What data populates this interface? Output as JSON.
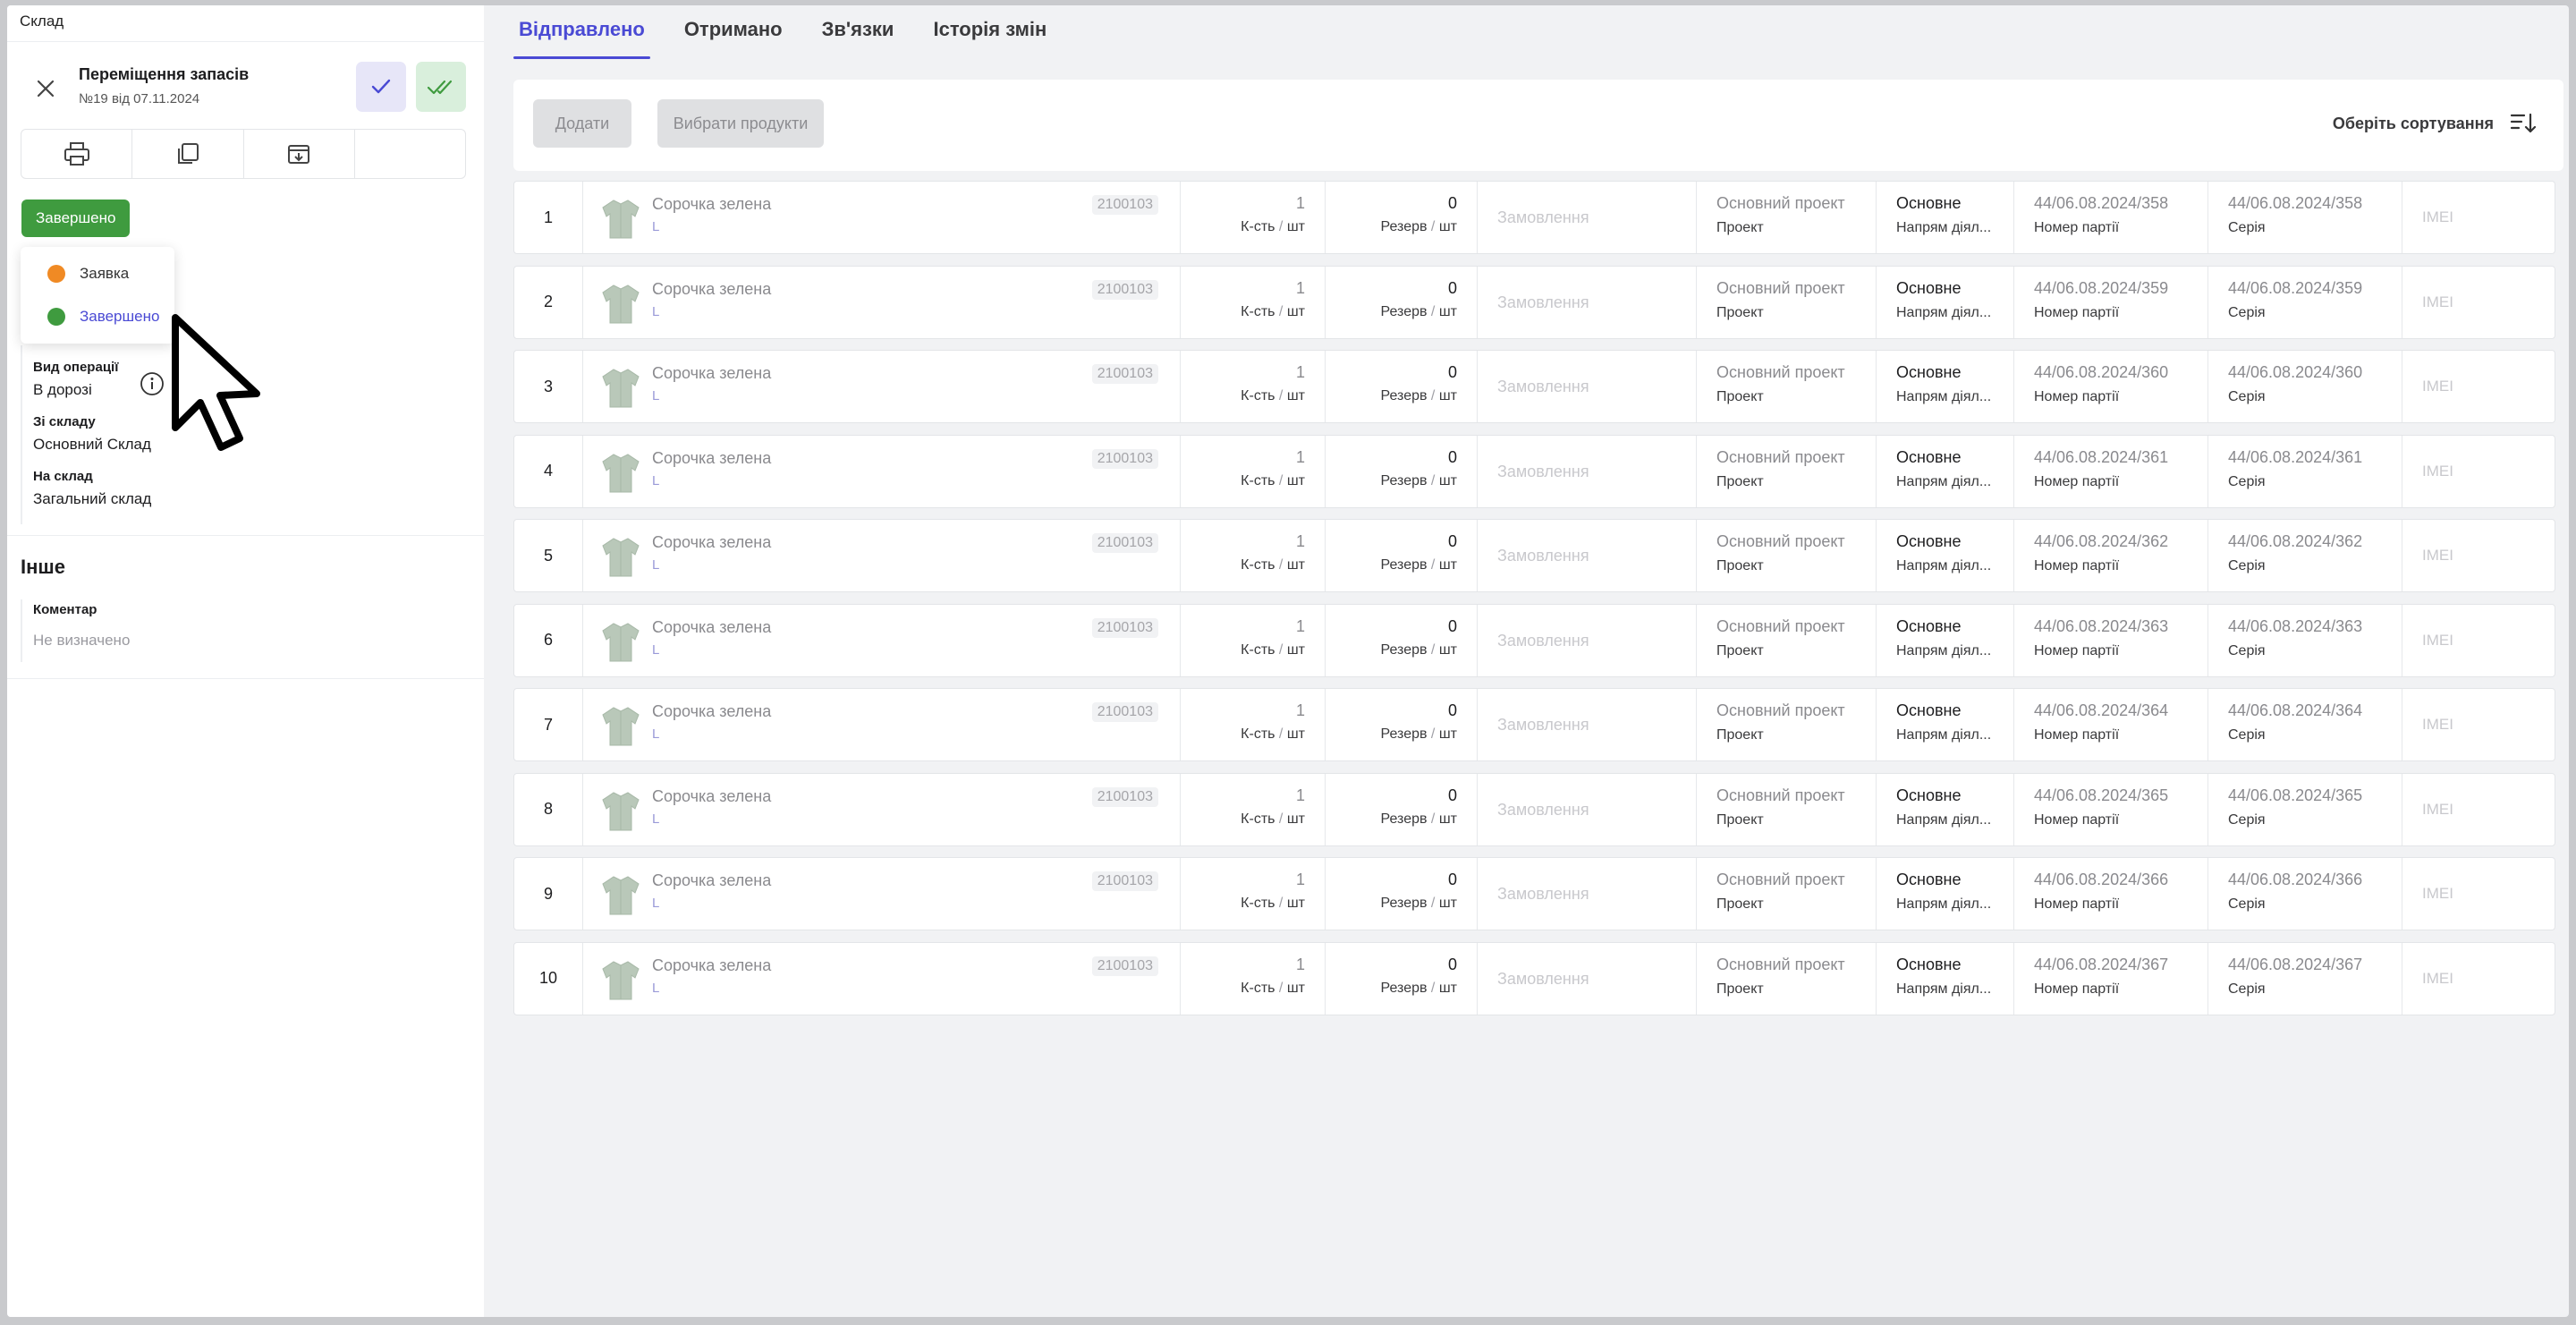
{
  "breadcrumb": "Склад",
  "document": {
    "title": "Переміщення запасів",
    "subtitle": "№19 від 07.11.2024"
  },
  "status": {
    "current": "Завершено",
    "options": [
      {
        "label": "Заявка",
        "color": "#f08a24"
      },
      {
        "label": "Завершено",
        "color": "#3f9b3f"
      }
    ]
  },
  "fields": {
    "operation_label": "Вид операції",
    "operation_value": "В дорозі",
    "from_label": "Зі складу",
    "from_value": "Основний Склад",
    "to_label": "На склад",
    "to_value": "Загальний склад"
  },
  "other": {
    "title": "Інше",
    "comment_label": "Коментар",
    "comment_value": "Не визначено"
  },
  "tabs": [
    "Відправлено",
    "Отримано",
    "Зв'язки",
    "Історія змін"
  ],
  "actions": {
    "add": "Додати",
    "select_products": "Вибрати продукти",
    "sort": "Оберіть сортування"
  },
  "colors": {
    "accent": "#4a4ad4",
    "success": "#3f9b3f",
    "warning": "#f08a24"
  },
  "rows": [
    {
      "num": "1",
      "name": "Сорочка зелена",
      "size": "L",
      "code": "2100103",
      "qty": "1",
      "qty_unit_a": "К-сть",
      "qty_unit_b": "шт",
      "res": "0",
      "res_unit_a": "Резерв",
      "res_unit_b": "шт",
      "order": "Замовлення",
      "project": "Основний проект",
      "project_label": "Проект",
      "direction": "Основне",
      "direction_label": "Напрям діял...",
      "batch": "44/06.08.2024/358",
      "batch_label": "Номер партії",
      "series": "44/06.08.2024/358",
      "series_label": "Серія",
      "imei": "IMEI"
    },
    {
      "num": "2",
      "name": "Сорочка зелена",
      "size": "L",
      "code": "2100103",
      "qty": "1",
      "qty_unit_a": "К-сть",
      "qty_unit_b": "шт",
      "res": "0",
      "res_unit_a": "Резерв",
      "res_unit_b": "шт",
      "order": "Замовлення",
      "project": "Основний проект",
      "project_label": "Проект",
      "direction": "Основне",
      "direction_label": "Напрям діял...",
      "batch": "44/06.08.2024/359",
      "batch_label": "Номер партії",
      "series": "44/06.08.2024/359",
      "series_label": "Серія",
      "imei": "IMEI"
    },
    {
      "num": "3",
      "name": "Сорочка зелена",
      "size": "L",
      "code": "2100103",
      "qty": "1",
      "qty_unit_a": "К-сть",
      "qty_unit_b": "шт",
      "res": "0",
      "res_unit_a": "Резерв",
      "res_unit_b": "шт",
      "order": "Замовлення",
      "project": "Основний проект",
      "project_label": "Проект",
      "direction": "Основне",
      "direction_label": "Напрям діял...",
      "batch": "44/06.08.2024/360",
      "batch_label": "Номер партії",
      "series": "44/06.08.2024/360",
      "series_label": "Серія",
      "imei": "IMEI"
    },
    {
      "num": "4",
      "name": "Сорочка зелена",
      "size": "L",
      "code": "2100103",
      "qty": "1",
      "qty_unit_a": "К-сть",
      "qty_unit_b": "шт",
      "res": "0",
      "res_unit_a": "Резерв",
      "res_unit_b": "шт",
      "order": "Замовлення",
      "project": "Основний проект",
      "project_label": "Проект",
      "direction": "Основне",
      "direction_label": "Напрям діял...",
      "batch": "44/06.08.2024/361",
      "batch_label": "Номер партії",
      "series": "44/06.08.2024/361",
      "series_label": "Серія",
      "imei": "IMEI"
    },
    {
      "num": "5",
      "name": "Сорочка зелена",
      "size": "L",
      "code": "2100103",
      "qty": "1",
      "qty_unit_a": "К-сть",
      "qty_unit_b": "шт",
      "res": "0",
      "res_unit_a": "Резерв",
      "res_unit_b": "шт",
      "order": "Замовлення",
      "project": "Основний проект",
      "project_label": "Проект",
      "direction": "Основне",
      "direction_label": "Напрям діял...",
      "batch": "44/06.08.2024/362",
      "batch_label": "Номер партії",
      "series": "44/06.08.2024/362",
      "series_label": "Серія",
      "imei": "IMEI"
    },
    {
      "num": "6",
      "name": "Сорочка зелена",
      "size": "L",
      "code": "2100103",
      "qty": "1",
      "qty_unit_a": "К-сть",
      "qty_unit_b": "шт",
      "res": "0",
      "res_unit_a": "Резерв",
      "res_unit_b": "шт",
      "order": "Замовлення",
      "project": "Основний проект",
      "project_label": "Проект",
      "direction": "Основне",
      "direction_label": "Напрям діял...",
      "batch": "44/06.08.2024/363",
      "batch_label": "Номер партії",
      "series": "44/06.08.2024/363",
      "series_label": "Серія",
      "imei": "IMEI"
    },
    {
      "num": "7",
      "name": "Сорочка зелена",
      "size": "L",
      "code": "2100103",
      "qty": "1",
      "qty_unit_a": "К-сть",
      "qty_unit_b": "шт",
      "res": "0",
      "res_unit_a": "Резерв",
      "res_unit_b": "шт",
      "order": "Замовлення",
      "project": "Основний проект",
      "project_label": "Проект",
      "direction": "Основне",
      "direction_label": "Напрям діял...",
      "batch": "44/06.08.2024/364",
      "batch_label": "Номер партії",
      "series": "44/06.08.2024/364",
      "series_label": "Серія",
      "imei": "IMEI"
    },
    {
      "num": "8",
      "name": "Сорочка зелена",
      "size": "L",
      "code": "2100103",
      "qty": "1",
      "qty_unit_a": "К-сть",
      "qty_unit_b": "шт",
      "res": "0",
      "res_unit_a": "Резерв",
      "res_unit_b": "шт",
      "order": "Замовлення",
      "project": "Основний проект",
      "project_label": "Проект",
      "direction": "Основне",
      "direction_label": "Напрям діял...",
      "batch": "44/06.08.2024/365",
      "batch_label": "Номер партії",
      "series": "44/06.08.2024/365",
      "series_label": "Серія",
      "imei": "IMEI"
    },
    {
      "num": "9",
      "name": "Сорочка зелена",
      "size": "L",
      "code": "2100103",
      "qty": "1",
      "qty_unit_a": "К-сть",
      "qty_unit_b": "шт",
      "res": "0",
      "res_unit_a": "Резерв",
      "res_unit_b": "шт",
      "order": "Замовлення",
      "project": "Основний проект",
      "project_label": "Проект",
      "direction": "Основне",
      "direction_label": "Напрям діял...",
      "batch": "44/06.08.2024/366",
      "batch_label": "Номер партії",
      "series": "44/06.08.2024/366",
      "series_label": "Серія",
      "imei": "IMEI"
    },
    {
      "num": "10",
      "name": "Сорочка зелена",
      "size": "L",
      "code": "2100103",
      "qty": "1",
      "qty_unit_a": "К-сть",
      "qty_unit_b": "шт",
      "res": "0",
      "res_unit_a": "Резерв",
      "res_unit_b": "шт",
      "order": "Замовлення",
      "project": "Основний проект",
      "project_label": "Проект",
      "direction": "Основне",
      "direction_label": "Напрям діял...",
      "batch": "44/06.08.2024/367",
      "batch_label": "Номер партії",
      "series": "44/06.08.2024/367",
      "series_label": "Серія",
      "imei": "IMEI"
    }
  ]
}
